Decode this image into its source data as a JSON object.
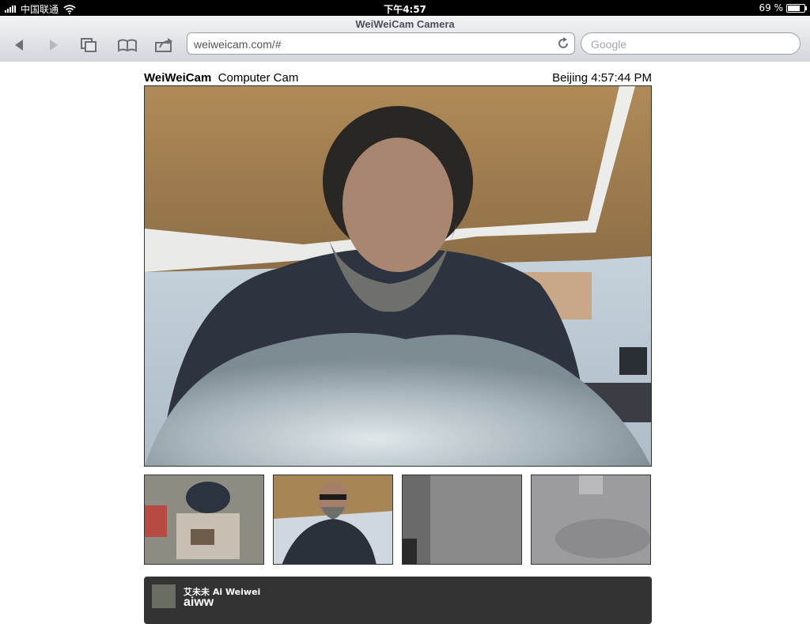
{
  "status": {
    "carrier": "中国联通",
    "time": "下午4:57",
    "battery": "69 %",
    "battery_level": 0.69
  },
  "browser": {
    "title": "WeiWeiCam Camera",
    "url": "weiweicam.com/#",
    "search_placeholder": "Google"
  },
  "page": {
    "brand": "WeiWeiCam",
    "cam_name": "Computer Cam",
    "clock": "Beijing 4:57:44 PM"
  },
  "tweet": {
    "name": "艾未未 Ai Weiwei",
    "handle": "aiww"
  }
}
